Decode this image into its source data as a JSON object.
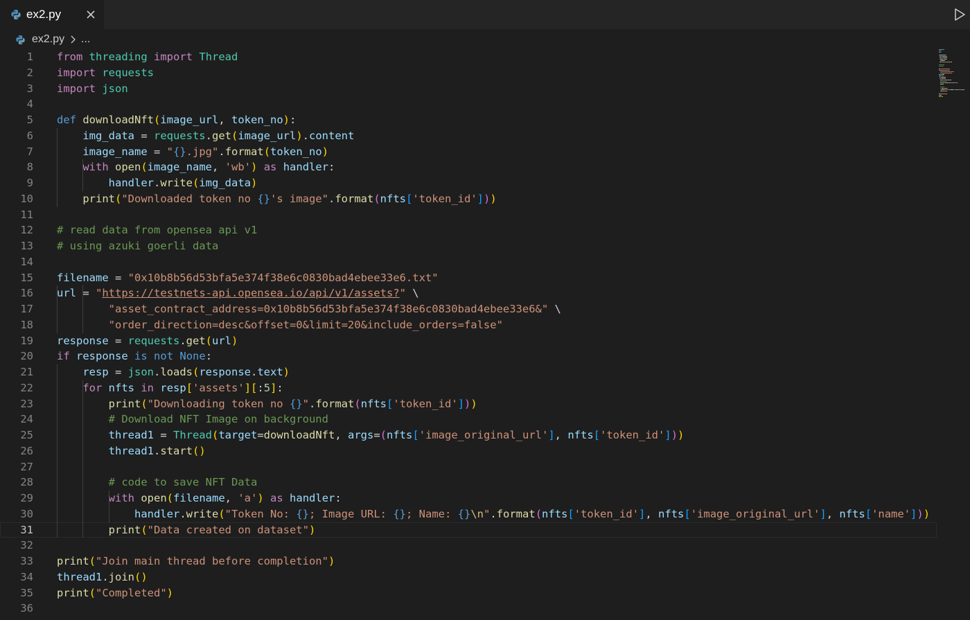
{
  "tab": {
    "label": "ex2.py"
  },
  "breadcrumb": {
    "file": "ex2.py",
    "rest": "..."
  },
  "editor": {
    "current_line": 31,
    "lines": [
      {
        "n": "1",
        "t": [
          [
            "k",
            "from"
          ],
          [
            "p",
            " "
          ],
          [
            "m",
            "threading"
          ],
          [
            "p",
            " "
          ],
          [
            "k",
            "import"
          ],
          [
            "p",
            " "
          ],
          [
            "m",
            "Thread"
          ]
        ]
      },
      {
        "n": "2",
        "t": [
          [
            "k",
            "import"
          ],
          [
            "p",
            " "
          ],
          [
            "m",
            "requests"
          ]
        ]
      },
      {
        "n": "3",
        "t": [
          [
            "k",
            "import"
          ],
          [
            "p",
            " "
          ],
          [
            "m",
            "json"
          ]
        ]
      },
      {
        "n": "4",
        "t": []
      },
      {
        "n": "5",
        "t": [
          [
            "d",
            "def"
          ],
          [
            "p",
            " "
          ],
          [
            "f",
            "downloadNft"
          ],
          [
            "b1",
            "("
          ],
          [
            "v",
            "image_url"
          ],
          [
            "p",
            ", "
          ],
          [
            "v",
            "token_no"
          ],
          [
            "b1",
            ")"
          ],
          [
            "p",
            ":"
          ]
        ]
      },
      {
        "n": "6",
        "t": [
          [
            "p",
            "    "
          ],
          [
            "v",
            "img_data"
          ],
          [
            "p",
            " = "
          ],
          [
            "m",
            "requests"
          ],
          [
            "p",
            "."
          ],
          [
            "f",
            "get"
          ],
          [
            "b1",
            "("
          ],
          [
            "v",
            "image_url"
          ],
          [
            "b1",
            ")"
          ],
          [
            "p",
            "."
          ],
          [
            "v",
            "content"
          ]
        ]
      },
      {
        "n": "7",
        "t": [
          [
            "p",
            "    "
          ],
          [
            "v",
            "image_name"
          ],
          [
            "p",
            " = "
          ],
          [
            "s",
            "\""
          ],
          [
            "d",
            "{}"
          ],
          [
            "s",
            ".jpg\""
          ],
          [
            "p",
            "."
          ],
          [
            "f",
            "format"
          ],
          [
            "b1",
            "("
          ],
          [
            "v",
            "token_no"
          ],
          [
            "b1",
            ")"
          ]
        ]
      },
      {
        "n": "8",
        "t": [
          [
            "p",
            "    "
          ],
          [
            "k",
            "with"
          ],
          [
            "p",
            " "
          ],
          [
            "f",
            "open"
          ],
          [
            "b1",
            "("
          ],
          [
            "v",
            "image_name"
          ],
          [
            "p",
            ", "
          ],
          [
            "s",
            "'wb'"
          ],
          [
            "b1",
            ")"
          ],
          [
            "p",
            " "
          ],
          [
            "k",
            "as"
          ],
          [
            "p",
            " "
          ],
          [
            "v",
            "handler"
          ],
          [
            "p",
            ":"
          ]
        ]
      },
      {
        "n": "9",
        "t": [
          [
            "p",
            "        "
          ],
          [
            "v",
            "handler"
          ],
          [
            "p",
            "."
          ],
          [
            "f",
            "write"
          ],
          [
            "b1",
            "("
          ],
          [
            "v",
            "img_data"
          ],
          [
            "b1",
            ")"
          ]
        ]
      },
      {
        "n": "10",
        "t": [
          [
            "p",
            "    "
          ],
          [
            "f",
            "print"
          ],
          [
            "b1",
            "("
          ],
          [
            "s",
            "\"Downloaded token no "
          ],
          [
            "d",
            "{}"
          ],
          [
            "s",
            "'s image\""
          ],
          [
            "p",
            "."
          ],
          [
            "f",
            "format"
          ],
          [
            "b2",
            "("
          ],
          [
            "v",
            "nfts"
          ],
          [
            "b3",
            "["
          ],
          [
            "s",
            "'token_id'"
          ],
          [
            "b3",
            "]"
          ],
          [
            "b2",
            ")"
          ],
          [
            "b1",
            ")"
          ]
        ]
      },
      {
        "n": "11",
        "t": []
      },
      {
        "n": "12",
        "t": [
          [
            "c",
            "# read data from opensea api v1"
          ]
        ]
      },
      {
        "n": "13",
        "t": [
          [
            "c",
            "# using azuki goerli data"
          ]
        ]
      },
      {
        "n": "14",
        "t": []
      },
      {
        "n": "15",
        "t": [
          [
            "v",
            "filename"
          ],
          [
            "p",
            " = "
          ],
          [
            "s",
            "\"0x10b8b56d53bfa5e374f38e6c0830bad4ebee33e6.txt\""
          ]
        ]
      },
      {
        "n": "16",
        "t": [
          [
            "v",
            "url"
          ],
          [
            "p",
            " = "
          ],
          [
            "s",
            "\""
          ],
          [
            "su",
            "https://testnets-api.opensea.io/api/v1/assets?"
          ],
          [
            "s",
            "\""
          ],
          [
            "p",
            " \\"
          ]
        ]
      },
      {
        "n": "17",
        "t": [
          [
            "p",
            "        "
          ],
          [
            "s",
            "\"asset_contract_address=0x10b8b56d53bfa5e374f38e6c0830bad4ebee33e6&\""
          ],
          [
            "p",
            " \\"
          ]
        ]
      },
      {
        "n": "18",
        "t": [
          [
            "p",
            "        "
          ],
          [
            "s",
            "\"order_direction=desc&offset=0&limit=20&include_orders=false\""
          ]
        ]
      },
      {
        "n": "19",
        "t": [
          [
            "v",
            "response"
          ],
          [
            "p",
            " = "
          ],
          [
            "m",
            "requests"
          ],
          [
            "p",
            "."
          ],
          [
            "f",
            "get"
          ],
          [
            "b1",
            "("
          ],
          [
            "v",
            "url"
          ],
          [
            "b1",
            ")"
          ]
        ]
      },
      {
        "n": "20",
        "t": [
          [
            "k",
            "if"
          ],
          [
            "p",
            " "
          ],
          [
            "v",
            "response"
          ],
          [
            "p",
            " "
          ],
          [
            "d",
            "is"
          ],
          [
            "p",
            " "
          ],
          [
            "d",
            "not"
          ],
          [
            "p",
            " "
          ],
          [
            "d",
            "None"
          ],
          [
            "p",
            ":"
          ]
        ]
      },
      {
        "n": "21",
        "t": [
          [
            "p",
            "    "
          ],
          [
            "v",
            "resp"
          ],
          [
            "p",
            " = "
          ],
          [
            "m",
            "json"
          ],
          [
            "p",
            "."
          ],
          [
            "f",
            "loads"
          ],
          [
            "b1",
            "("
          ],
          [
            "v",
            "response"
          ],
          [
            "p",
            "."
          ],
          [
            "v",
            "text"
          ],
          [
            "b1",
            ")"
          ]
        ]
      },
      {
        "n": "22",
        "t": [
          [
            "p",
            "    "
          ],
          [
            "k",
            "for"
          ],
          [
            "p",
            " "
          ],
          [
            "v",
            "nfts"
          ],
          [
            "p",
            " "
          ],
          [
            "k",
            "in"
          ],
          [
            "p",
            " "
          ],
          [
            "v",
            "resp"
          ],
          [
            "b1",
            "["
          ],
          [
            "s",
            "'assets'"
          ],
          [
            "b1",
            "]"
          ],
          [
            "b1",
            "["
          ],
          [
            "p",
            ":"
          ],
          [
            "n",
            "5"
          ],
          [
            "b1",
            "]"
          ],
          [
            "p",
            ":"
          ]
        ]
      },
      {
        "n": "23",
        "t": [
          [
            "p",
            "        "
          ],
          [
            "f",
            "print"
          ],
          [
            "b1",
            "("
          ],
          [
            "s",
            "\"Downloading token no "
          ],
          [
            "d",
            "{}"
          ],
          [
            "s",
            "\""
          ],
          [
            "p",
            "."
          ],
          [
            "f",
            "format"
          ],
          [
            "b2",
            "("
          ],
          [
            "v",
            "nfts"
          ],
          [
            "b3",
            "["
          ],
          [
            "s",
            "'token_id'"
          ],
          [
            "b3",
            "]"
          ],
          [
            "b2",
            ")"
          ],
          [
            "b1",
            ")"
          ]
        ]
      },
      {
        "n": "24",
        "t": [
          [
            "p",
            "        "
          ],
          [
            "c",
            "# Download NFT Image on background"
          ]
        ]
      },
      {
        "n": "25",
        "t": [
          [
            "p",
            "        "
          ],
          [
            "v",
            "thread1"
          ],
          [
            "p",
            " = "
          ],
          [
            "m",
            "Thread"
          ],
          [
            "b1",
            "("
          ],
          [
            "v",
            "target"
          ],
          [
            "p",
            "="
          ],
          [
            "f",
            "downloadNft"
          ],
          [
            "p",
            ", "
          ],
          [
            "v",
            "args"
          ],
          [
            "p",
            "="
          ],
          [
            "b2",
            "("
          ],
          [
            "v",
            "nfts"
          ],
          [
            "b3",
            "["
          ],
          [
            "s",
            "'image_original_url'"
          ],
          [
            "b3",
            "]"
          ],
          [
            "p",
            ", "
          ],
          [
            "v",
            "nfts"
          ],
          [
            "b3",
            "["
          ],
          [
            "s",
            "'token_id'"
          ],
          [
            "b3",
            "]"
          ],
          [
            "b2",
            ")"
          ],
          [
            "b1",
            ")"
          ]
        ]
      },
      {
        "n": "26",
        "t": [
          [
            "p",
            "        "
          ],
          [
            "v",
            "thread1"
          ],
          [
            "p",
            "."
          ],
          [
            "f",
            "start"
          ],
          [
            "b1",
            "()"
          ]
        ]
      },
      {
        "n": "27",
        "t": []
      },
      {
        "n": "28",
        "t": [
          [
            "p",
            "        "
          ],
          [
            "c",
            "# code to save NFT Data"
          ]
        ]
      },
      {
        "n": "29",
        "t": [
          [
            "p",
            "        "
          ],
          [
            "k",
            "with"
          ],
          [
            "p",
            " "
          ],
          [
            "f",
            "open"
          ],
          [
            "b1",
            "("
          ],
          [
            "v",
            "filename"
          ],
          [
            "p",
            ", "
          ],
          [
            "s",
            "'a'"
          ],
          [
            "b1",
            ")"
          ],
          [
            "p",
            " "
          ],
          [
            "k",
            "as"
          ],
          [
            "p",
            " "
          ],
          [
            "v",
            "handler"
          ],
          [
            "p",
            ":"
          ]
        ]
      },
      {
        "n": "30",
        "t": [
          [
            "p",
            "            "
          ],
          [
            "v",
            "handler"
          ],
          [
            "p",
            "."
          ],
          [
            "f",
            "write"
          ],
          [
            "b1",
            "("
          ],
          [
            "s",
            "\"Token No: "
          ],
          [
            "d",
            "{}"
          ],
          [
            "s",
            "; Image URL: "
          ],
          [
            "d",
            "{}"
          ],
          [
            "s",
            "; Name: "
          ],
          [
            "d",
            "{}"
          ],
          [
            "esc",
            "\\n"
          ],
          [
            "s",
            "\""
          ],
          [
            "p",
            "."
          ],
          [
            "f",
            "format"
          ],
          [
            "b2",
            "("
          ],
          [
            "v",
            "nfts"
          ],
          [
            "b3",
            "["
          ],
          [
            "s",
            "'token_id'"
          ],
          [
            "b3",
            "]"
          ],
          [
            "p",
            ", "
          ],
          [
            "v",
            "nfts"
          ],
          [
            "b3",
            "["
          ],
          [
            "s",
            "'image_original_url'"
          ],
          [
            "b3",
            "]"
          ],
          [
            "p",
            ", "
          ],
          [
            "v",
            "nfts"
          ],
          [
            "b3",
            "["
          ],
          [
            "s",
            "'name'"
          ],
          [
            "b3",
            "]"
          ],
          [
            "b2",
            ")"
          ],
          [
            "b1",
            ")"
          ]
        ]
      },
      {
        "n": "31",
        "t": [
          [
            "p",
            "        "
          ],
          [
            "f",
            "print"
          ],
          [
            "b1",
            "("
          ],
          [
            "s",
            "\"Data created on dataset\""
          ],
          [
            "b1",
            ")"
          ]
        ]
      },
      {
        "n": "32",
        "t": []
      },
      {
        "n": "33",
        "t": [
          [
            "f",
            "print"
          ],
          [
            "b1",
            "("
          ],
          [
            "s",
            "\"Join main thread before completion\""
          ],
          [
            "b1",
            ")"
          ]
        ]
      },
      {
        "n": "34",
        "t": [
          [
            "v",
            "thread1"
          ],
          [
            "p",
            "."
          ],
          [
            "f",
            "join"
          ],
          [
            "b1",
            "()"
          ]
        ]
      },
      {
        "n": "35",
        "t": [
          [
            "f",
            "print"
          ],
          [
            "b1",
            "("
          ],
          [
            "s",
            "\"Completed\""
          ],
          [
            "b1",
            ")"
          ]
        ]
      },
      {
        "n": "36",
        "t": []
      }
    ]
  }
}
